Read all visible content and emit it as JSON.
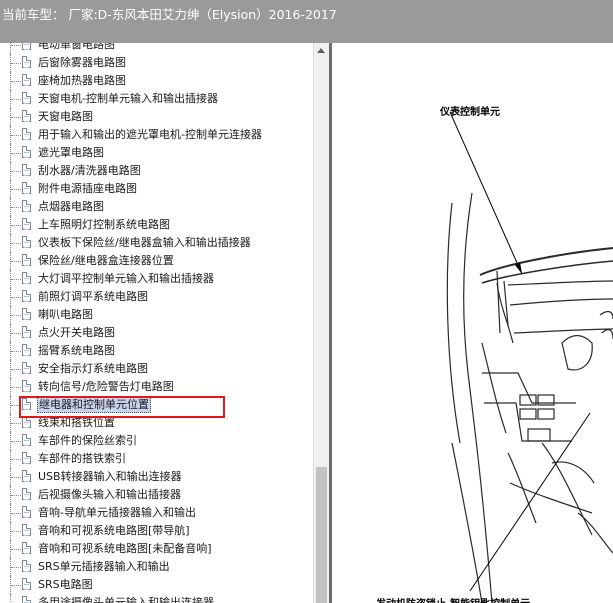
{
  "header": {
    "title": "当前车型：  厂家:D-东风本田艾力绅（Elysion）2016-2017"
  },
  "tree": {
    "items": [
      {
        "label": "电动車窗电路图"
      },
      {
        "label": "后窗除雾器电路图"
      },
      {
        "label": "座椅加热器电路图"
      },
      {
        "label": "天窗电机-控制单元输入和输出插接器"
      },
      {
        "label": "天窗电路图"
      },
      {
        "label": "用于输入和输出的遮光罩电机-控制单元连接器"
      },
      {
        "label": "遮光罩电路图"
      },
      {
        "label": "刮水器/清洗器电路图"
      },
      {
        "label": "附件电源插座电路图"
      },
      {
        "label": "点烟器电路图"
      },
      {
        "label": "上车照明灯控制系统电路图"
      },
      {
        "label": "仪表板下保险丝/继电器盒输入和输出插接器"
      },
      {
        "label": "保险丝/继电器盒连接器位置"
      },
      {
        "label": "大灯调平控制单元输入和输出插接器"
      },
      {
        "label": "前照灯调平系统电路图"
      },
      {
        "label": "喇叭电路图"
      },
      {
        "label": "点火开关电路图"
      },
      {
        "label": "摇臂系统电路图"
      },
      {
        "label": "安全指示灯系统电路图"
      },
      {
        "label": "转向信号/危险警告灯电路图"
      },
      {
        "label": "继电器和控制单元位置",
        "selected": true
      },
      {
        "label": "线束和搭铁位置"
      },
      {
        "label": "车部件的保险丝索引"
      },
      {
        "label": "车部件的搭铁索引"
      },
      {
        "label": "USB转接器输入和输出连接器"
      },
      {
        "label": "后视摄像头输入和输出插接器"
      },
      {
        "label": "音响-导航单元插接器输入和输出"
      },
      {
        "label": "音响和可视系统电路图[带导航]"
      },
      {
        "label": "音响和可视系统电路图[未配备音响]"
      },
      {
        "label": "SRS单元插接器输入和输出"
      },
      {
        "label": "SRS电路图"
      },
      {
        "label": "多用途摄像头单元输入和输出连接器"
      }
    ]
  },
  "viewer": {
    "callout_top": "仪表控制单元",
    "callout_bottom": "发动机防盗锁止-智能钥匙控制单元"
  },
  "colors": {
    "highlight_box": "#e01818",
    "titlebar": "#9a9a9a"
  }
}
